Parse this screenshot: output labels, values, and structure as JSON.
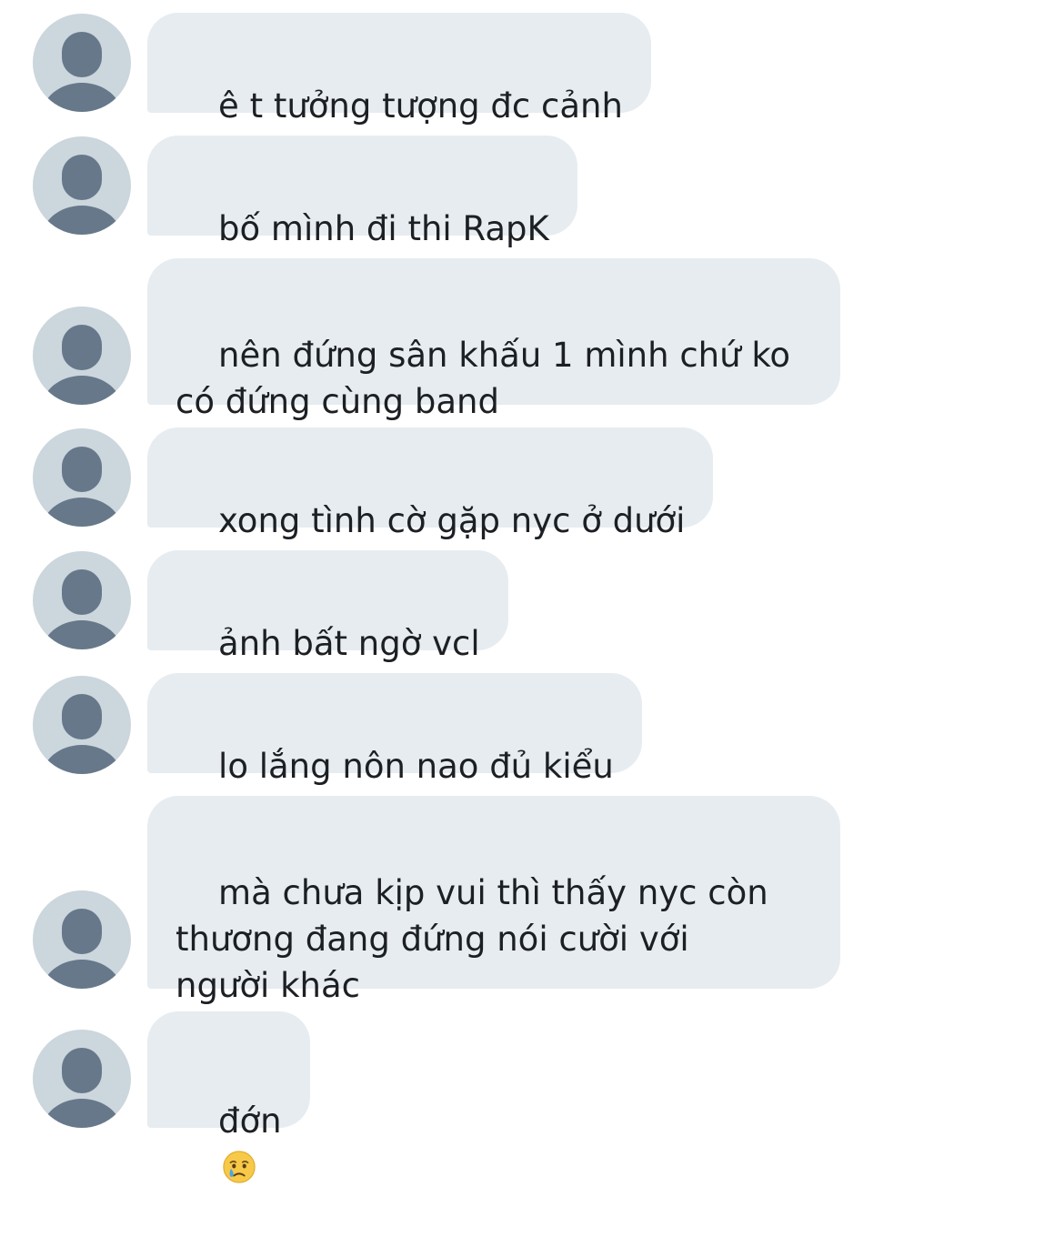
{
  "conversation": {
    "messages": [
      {
        "text": "ê t tưởng tượng đc cảnh"
      },
      {
        "text": "bố mình đi thi RapK"
      },
      {
        "text": "nên đứng sân khấu 1 mình chứ ko\ncó đứng cùng band"
      },
      {
        "text": "xong tình cờ gặp nyc ở dưới"
      },
      {
        "text": "ảnh bất ngờ vcl"
      },
      {
        "text": "lo lắng nôn nao đủ kiểu"
      },
      {
        "text": "mà chưa kịp vui thì thấy nyc còn\nthương đang đứng nói cười với\nngười khác"
      },
      {
        "text": "đớn",
        "emoji": "crying-face-emoji"
      }
    ]
  },
  "colors": {
    "bubble": "#e7ecf0",
    "avatar_bg": "#ccd6dd",
    "avatar_fg": "#66788a",
    "text": "#1c1f23"
  }
}
